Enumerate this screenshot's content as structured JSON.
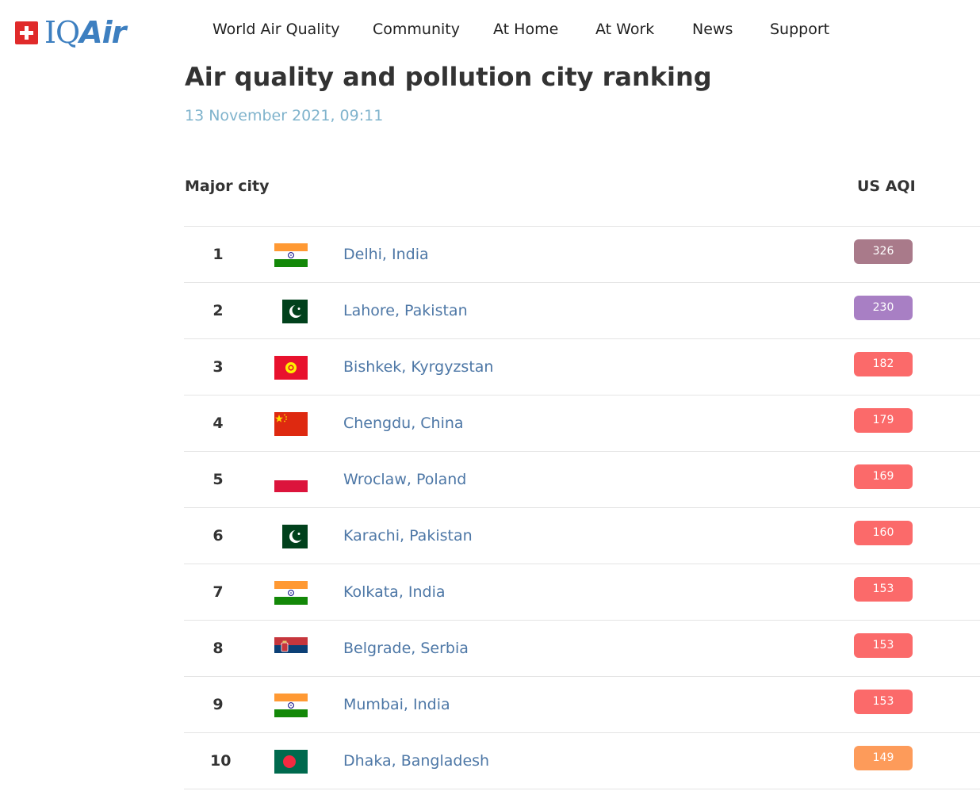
{
  "logo": {
    "brand_iq": "IQ",
    "brand_air": "Air"
  },
  "nav": [
    "World Air Quality",
    "Community",
    "At Home",
    "At Work",
    "News",
    "Support"
  ],
  "page": {
    "title": "Air quality and pollution city ranking",
    "date": "13 November 2021, 09:11"
  },
  "table": {
    "col_city": "Major city",
    "col_aqi": "US AQI",
    "rows": [
      {
        "rank": "1",
        "city": "Delhi, India",
        "flag": "india-flag",
        "aqi": "326",
        "color": "#a97a8a"
      },
      {
        "rank": "2",
        "city": "Lahore, Pakistan",
        "flag": "pakistan-flag",
        "aqi": "230",
        "color": "#a87fc4"
      },
      {
        "rank": "3",
        "city": "Bishkek, Kyrgyzstan",
        "flag": "kyrgyzstan-flag",
        "aqi": "182",
        "color": "#fb6a6a"
      },
      {
        "rank": "4",
        "city": "Chengdu, China",
        "flag": "china-flag",
        "aqi": "179",
        "color": "#fb6a6a"
      },
      {
        "rank": "5",
        "city": "Wroclaw, Poland",
        "flag": "poland-flag",
        "aqi": "169",
        "color": "#fb6a6a"
      },
      {
        "rank": "6",
        "city": "Karachi, Pakistan",
        "flag": "pakistan-flag",
        "aqi": "160",
        "color": "#fb6a6a"
      },
      {
        "rank": "7",
        "city": "Kolkata, India",
        "flag": "india-flag",
        "aqi": "153",
        "color": "#fb6a6a"
      },
      {
        "rank": "8",
        "city": "Belgrade, Serbia",
        "flag": "serbia-flag",
        "aqi": "153",
        "color": "#fb6a6a"
      },
      {
        "rank": "9",
        "city": "Mumbai, India",
        "flag": "india-flag",
        "aqi": "153",
        "color": "#fb6a6a"
      },
      {
        "rank": "10",
        "city": "Dhaka, Bangladesh",
        "flag": "bangladesh-flag",
        "aqi": "149",
        "color": "#fd9b5a"
      }
    ]
  }
}
